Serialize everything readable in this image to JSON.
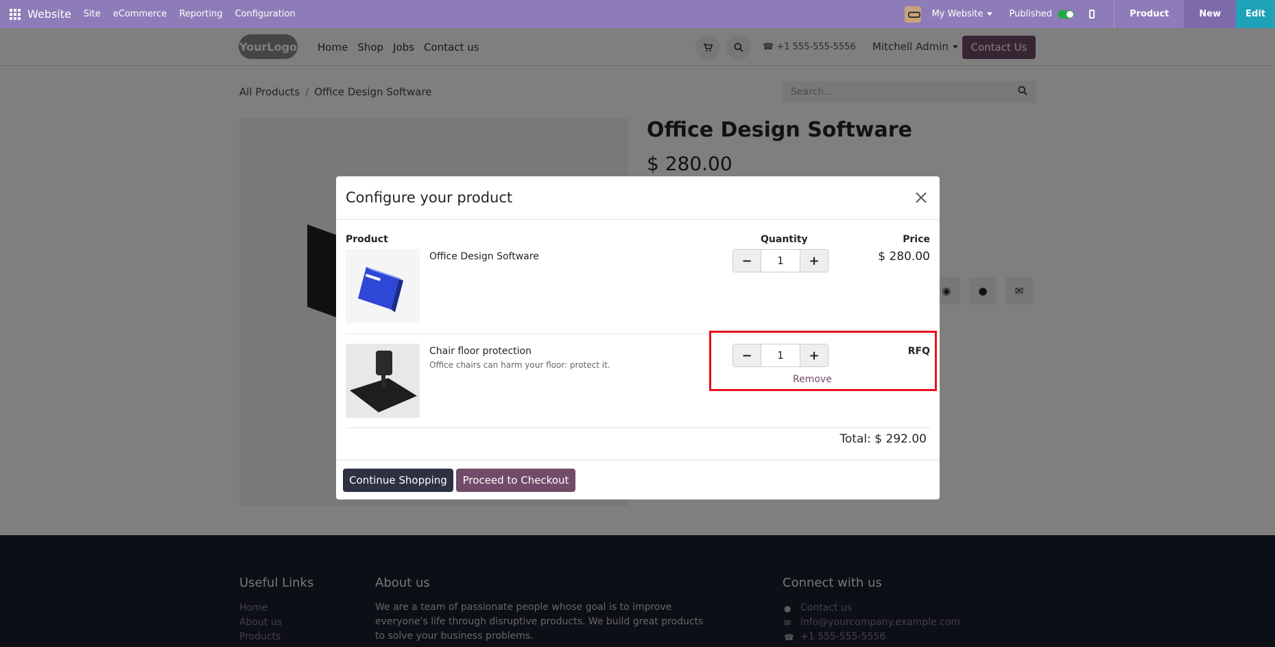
{
  "admin_bar": {
    "brand": "Website",
    "menu": [
      "Site",
      "eCommerce",
      "Reporting",
      "Configuration"
    ],
    "my_website": "My Website",
    "published": "Published",
    "product": "Product",
    "new": "New",
    "edit": "Edit"
  },
  "header": {
    "logo": "YourLogo",
    "nav": [
      "Home",
      "Shop",
      "Jobs",
      "Contact us"
    ],
    "phone": "+1 555-555-5556",
    "user": "Mitchell Admin",
    "contact_button": "Contact Us"
  },
  "page": {
    "breadcrumb": [
      "All Products",
      "Office Design Software"
    ],
    "search_placeholder": "Search...",
    "product_title": "Office Design Software",
    "product_price": "$ 280.00"
  },
  "modal": {
    "title": "Configure your product",
    "col_product": "Product",
    "col_quantity": "Quantity",
    "col_price": "Price",
    "rows": [
      {
        "name": "Office Design Software",
        "description": "",
        "quantity": "1",
        "price": "$ 280.00"
      },
      {
        "name": "Chair floor protection",
        "description": "Office chairs can harm your floor: protect it.",
        "quantity": "1",
        "price": "RFQ"
      }
    ],
    "remove_label": "Remove",
    "total": "Total: $ 292.00",
    "continue_label": "Continue Shopping",
    "checkout_label": "Proceed to Checkout"
  },
  "footer": {
    "useful_links_title": "Useful Links",
    "useful_links": [
      "Home",
      "About us",
      "Products"
    ],
    "about_title": "About us",
    "about_text": "We are a team of passionate people whose goal is to improve everyone's life through disruptive products. We build great products to solve your business problems.",
    "connect_title": "Connect with us",
    "connect_links": [
      "Contact us",
      "info@yourcompany.example.com",
      "+1 555-555-5556"
    ]
  },
  "colors": {
    "admin_bar": "#8e7cb8",
    "brand_primary": "#714b67",
    "highlight_border": "#e8101a",
    "footer_bg": "#1b1f2c",
    "edit_button": "#1fa2b8"
  }
}
